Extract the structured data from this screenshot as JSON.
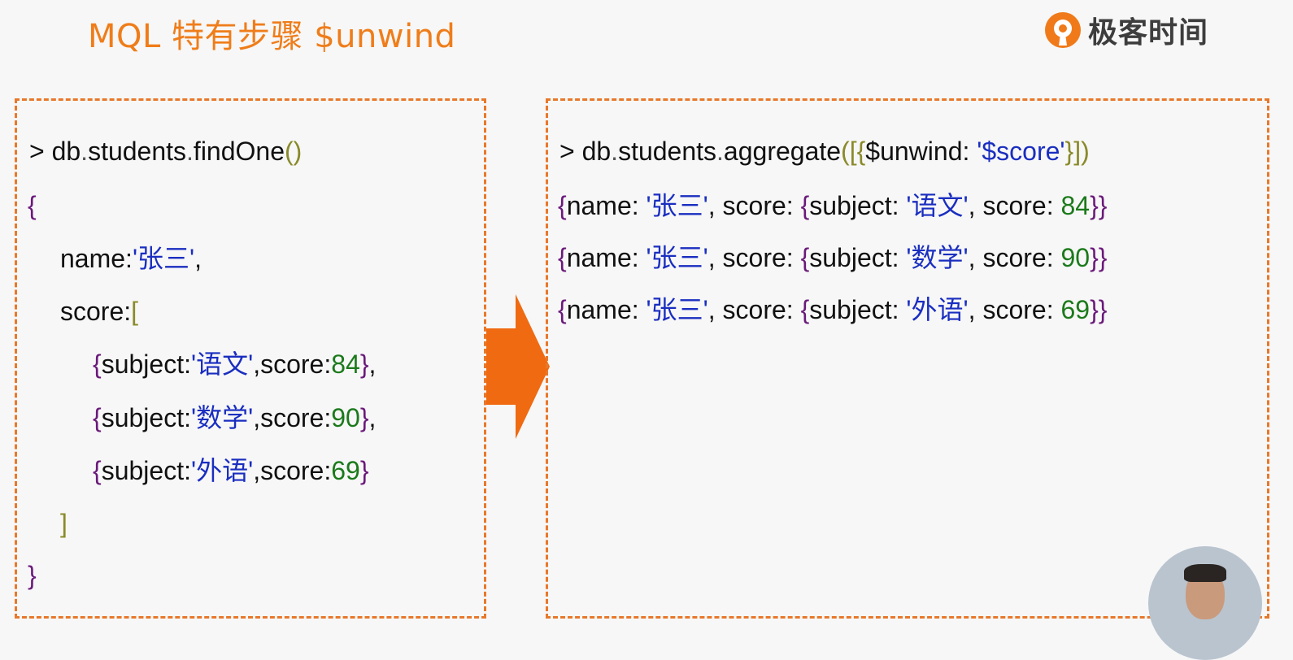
{
  "header": {
    "title": "MQL 特有步骤 $unwind",
    "logo_text": "极客时间"
  },
  "left_panel": {
    "command": {
      "prompt": ">",
      "db": "db",
      "collection": "students",
      "method": "findOne",
      "open": "(",
      "close": ")"
    },
    "doc_open": "{",
    "name_key": "name:",
    "name_value": "'张三'",
    "comma": ",",
    "score_key": "score:",
    "array_open": "[",
    "items": [
      {
        "subject": "'语文'",
        "score": "84",
        "trail": ","
      },
      {
        "subject": "'数学'",
        "score": "90",
        "trail": ","
      },
      {
        "subject": "'外语'",
        "score": "69",
        "trail": ""
      }
    ],
    "array_close": "]",
    "doc_close": "}"
  },
  "right_panel": {
    "command": {
      "prompt": ">",
      "db": "db",
      "collection": "students",
      "method": "aggregate",
      "open": "([{",
      "stage": "$unwind: ",
      "field": "'$score'",
      "close": "}])"
    },
    "results": [
      {
        "name": "'张三'",
        "subject": "'语文'",
        "score": "84"
      },
      {
        "name": "'张三'",
        "subject": "'数学'",
        "score": "90"
      },
      {
        "name": "'张三'",
        "subject": "'外语'",
        "score": "69"
      }
    ]
  },
  "labels": {
    "subject_key": "subject:",
    "score_key": "score:",
    "name_key": "name: ",
    "score_key_sp": "score: ",
    "subject_key_sp": "subject: ",
    "sep": ", ",
    "lbrace": "{",
    "rbrace": "}",
    "rbrace2": "}}",
    "dot": "."
  },
  "colors": {
    "accent": "#ef7d1a",
    "dash_border": "#e8782a",
    "arrow": "#f06a12",
    "string": "#1a2ec0",
    "number": "#1b7a1b",
    "brace": "#6a1a7a",
    "bracket": "#8a8a2a"
  }
}
